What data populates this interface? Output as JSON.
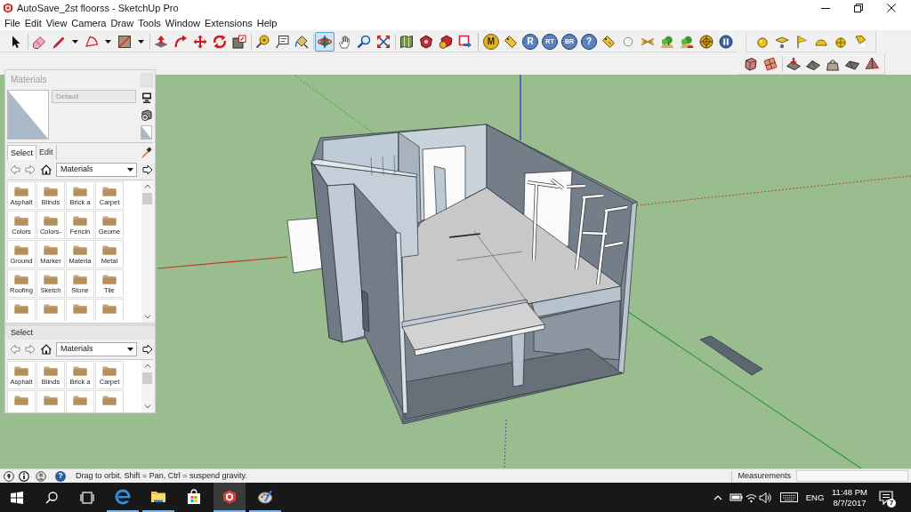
{
  "window": {
    "title": "AutoSave_2st floorss - SketchUp Pro"
  },
  "menu": [
    "File",
    "Edit",
    "View",
    "Camera",
    "Draw",
    "Tools",
    "Window",
    "Extensions",
    "Help"
  ],
  "toolbars": [
    {
      "tools": [
        {
          "selected": false
        }
      ]
    },
    {
      "tools": [
        {
          "selected": false
        },
        {
          "selected": false
        },
        {
          "selected": false
        },
        {
          "selected": false
        }
      ]
    },
    {
      "tools": [
        {
          "selected": false
        },
        {
          "selected": false
        },
        {
          "selected": false
        },
        {
          "selected": false
        },
        {
          "selected": false
        }
      ]
    },
    {
      "tools": [
        {
          "selected": false
        },
        {
          "selected": false
        },
        {
          "selected": false
        }
      ]
    },
    {
      "tools": [
        {
          "selected": true
        },
        {
          "selected": false
        },
        {
          "selected": false
        },
        {
          "selected": false
        }
      ]
    },
    {
      "tools": [
        {
          "selected": false
        },
        {
          "selected": false
        },
        {
          "selected": false
        },
        {
          "selected": false
        }
      ]
    },
    {
      "tools": [
        {
          "label": "M",
          "selected": false
        },
        {
          "selected": false
        },
        {
          "label": "R",
          "selected": false
        },
        {
          "label": "RT",
          "selected": false
        },
        {
          "label": "BR",
          "selected": false
        },
        {
          "label": "?",
          "selected": false
        },
        {
          "selected": false
        },
        {
          "selected": false
        },
        {
          "selected": false
        },
        {
          "selected": false
        },
        {
          "selected": false
        },
        {
          "selected": false
        },
        {
          "selected": false
        }
      ]
    },
    {
      "tools": [
        {
          "selected": false
        },
        {
          "selected": false
        },
        {
          "selected": false
        },
        {
          "selected": false
        },
        {
          "selected": false
        },
        {
          "selected": false
        }
      ]
    },
    {
      "tools": [
        {
          "selected": false
        },
        {
          "selected": false
        }
      ]
    },
    {
      "tools": [
        {
          "selected": false
        },
        {
          "selected": false
        },
        {
          "selected": false
        },
        {
          "selected": false
        },
        {
          "selected": false
        }
      ]
    }
  ],
  "materials_panel": {
    "title": "Materials",
    "material_name": "Default",
    "tabs": [
      {
        "label": "Select",
        "selected": true
      },
      {
        "label": "Edit",
        "selected": false
      }
    ],
    "library": "Materials",
    "materials": [
      "Asphalt",
      "Blinds",
      "Brick a",
      "Carpet",
      "Colors",
      "Colors-",
      "Fencin",
      "Geome",
      "Ground",
      "Marker",
      "Materia",
      "Metal",
      "Roofing",
      "Sketch",
      "Stone",
      "Tile"
    ],
    "secondary_pane": {
      "title": "Select",
      "library": "Materials",
      "materials": [
        "Asphalt",
        "Blinds",
        "Brick a",
        "Carpet"
      ]
    }
  },
  "status_bar": {
    "help_label": "?",
    "message": "Drag to orbit. Shift = Pan, Ctrl = suspend gravity.",
    "measurements_label": "Measurements"
  },
  "taskbar": {
    "apps": [
      {
        "running": true,
        "selected": false
      },
      {
        "running": true,
        "selected": false
      },
      {
        "running": false,
        "selected": false
      },
      {
        "running": true,
        "selected": true
      },
      {
        "running": true,
        "selected": false
      }
    ],
    "language": "ENG",
    "time": "11:48 PM",
    "date": "8/7/2017",
    "notification_count": "7"
  }
}
